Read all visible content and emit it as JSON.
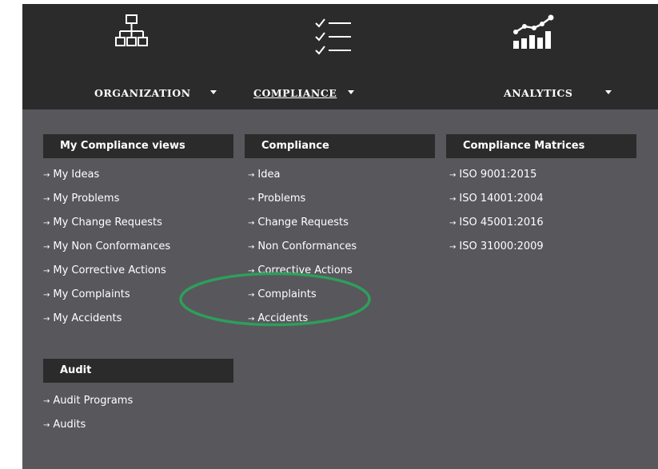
{
  "nav": {
    "organization": "ORGANIZATION",
    "compliance": "COMPLIANCE",
    "analytics": "ANALYTICS"
  },
  "sections": {
    "my_views": {
      "title": "My Compliance views",
      "items": [
        "My Ideas",
        "My Problems",
        "My Change Requests",
        "My Non Conformances",
        "My Corrective Actions",
        "My Complaints",
        "My Accidents"
      ]
    },
    "compliance": {
      "title": "Compliance",
      "items": [
        "Idea",
        "Problems",
        "Change Requests",
        "Non Conformances",
        "Corrective Actions",
        "Complaints",
        "Accidents"
      ]
    },
    "matrices": {
      "title": "Compliance Matrices",
      "items": [
        "ISO 9001:2015",
        "ISO 14001:2004",
        "ISO 45001:2016",
        "ISO 31000:2009"
      ]
    },
    "audit": {
      "title": "Audit",
      "items": [
        "Audit Programs",
        "Audits"
      ]
    }
  },
  "arrow_glyph": "→",
  "colors": {
    "header_bg": "#2b2b2b",
    "panel_bg": "#58575c",
    "text": "#ffffff",
    "highlight": "#2e9e5b"
  },
  "icons": {
    "organization": "org-chart-icon",
    "compliance": "checklist-icon",
    "analytics": "bar-chart-trend-icon"
  }
}
